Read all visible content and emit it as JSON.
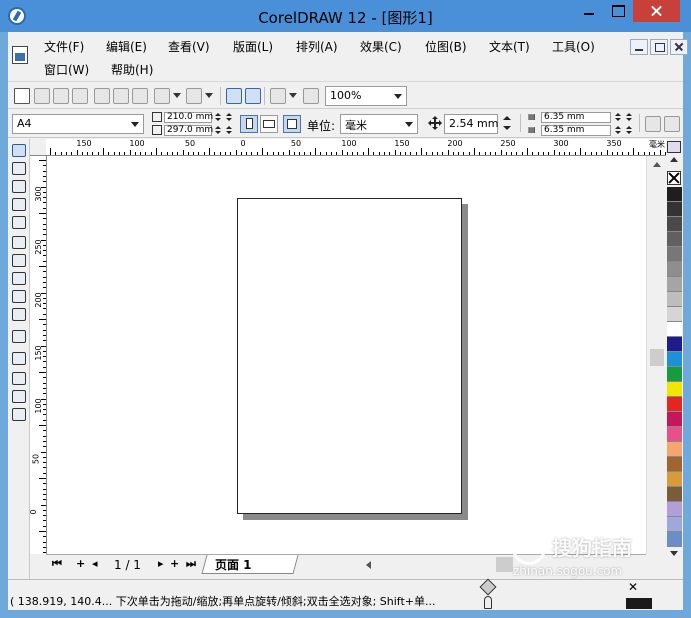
{
  "window": {
    "title": "CorelDRAW 12 - [图形1]"
  },
  "menu": {
    "row1": [
      "文件(F)",
      "编辑(E)",
      "查看(V)",
      "版面(L)",
      "排列(A)",
      "效果(C)",
      "位图(B)",
      "文本(T)",
      "工具(O)"
    ],
    "row2": [
      "窗口(W)",
      "帮助(H)"
    ]
  },
  "toolbar": {
    "zoom": "100%"
  },
  "property_bar": {
    "paper_size": "A4",
    "width": "210.0 mm",
    "height": "297.0 mm",
    "unit_label": "单位:",
    "unit_value": "毫米",
    "nudge": "2.54 mm",
    "dup_x": "6.35 mm",
    "dup_y": "6.35 mm"
  },
  "ruler": {
    "horizontal": [
      "150",
      "100",
      "50",
      "0",
      "50",
      "100",
      "150",
      "200",
      "250",
      "300",
      "350",
      "毫米"
    ],
    "vertical": [
      "300",
      "250",
      "200",
      "150",
      "100",
      "50",
      "0"
    ]
  },
  "navigator": {
    "page_count": "1 / 1",
    "page_tab": "页面 1"
  },
  "status": {
    "text": "( 138.919, 140.4...  下次单击为拖动/缩放;再单点旋转/倾斜;双击全选对象; Shift+单...",
    "close_glyph": "✕"
  },
  "palette": {
    "colors": [
      "#1e1e1e",
      "#333333",
      "#4a4a4a",
      "#606060",
      "#777777",
      "#8e8e8e",
      "#a5a5a5",
      "#bdbdbd",
      "#d5d5d5",
      "#ffffff",
      "#1f1a8c",
      "#1e90d8",
      "#169c3c",
      "#f2e600",
      "#e52620",
      "#c2185b",
      "#e8508a",
      "#f5a56e",
      "#a0652e",
      "#d89a3a",
      "#7a5c3a",
      "#b39ddb",
      "#9fa8da",
      "#6a8fc8"
    ]
  },
  "watermark": {
    "text": "搜狗指南",
    "url": "zhinan.sogou.com"
  }
}
